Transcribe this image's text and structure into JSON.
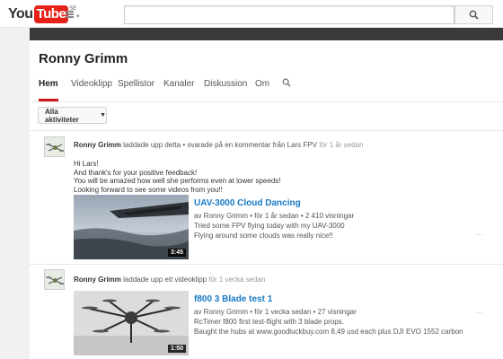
{
  "masthead": {
    "logo_you": "You",
    "logo_tube": "Tube",
    "logo_country": "SE",
    "search_placeholder": ""
  },
  "channel": {
    "name": "Ronny Grimm",
    "tabs": [
      "Hem",
      "Videoklipp",
      "Spellistor",
      "Kanaler",
      "Diskussion",
      "Om"
    ]
  },
  "feed": {
    "filter_label": "Alla aktiviteter",
    "items": [
      {
        "author": "Ronny Grimm",
        "action": "laddade upp detta • svarade på en kommentar från Lars FPV",
        "time": "för 1 år sedan",
        "comment_lines": [
          "Hi Lars!",
          "And thank's for your positive feedback!",
          "You will be amazed how well she performs even at lower speeds!",
          "Looking forward to see some videos from you!!"
        ],
        "video": {
          "title": "UAV-3000 Cloud Dancing",
          "meta": "av Ronny Grimm • för 1 år sedan • 2 410 visningar",
          "desc_lines": [
            "Tried some FPV flying today with my UAV-3000",
            "Flying around some clouds was really nice!!"
          ],
          "duration": "3:45",
          "more": "..."
        }
      },
      {
        "author": "Ronny Grimm",
        "action": "laddade upp ett videoklipp",
        "time": "för 1 vecka sedan",
        "video": {
          "title": "f800 3 Blade test 1",
          "meta": "av Ronny Grimm • för 1 vecka sedan • 27 visningar",
          "desc_lines": [
            "RcTimer f800 first test-flight with 3 blade props.",
            "Baught the hubs at www.goodluckbuy.com 8,49 usd each plus DJI EVO 1552 carbon"
          ],
          "duration": "1:50",
          "more": "..."
        }
      }
    ]
  },
  "colors": {
    "brand_red": "#e62117",
    "link_blue": "#167ac6",
    "tab_underline": "#cc181e"
  },
  "icons": [
    "guide-menu-icon",
    "search-icon",
    "chevron-down-icon",
    "avatar-drone"
  ]
}
